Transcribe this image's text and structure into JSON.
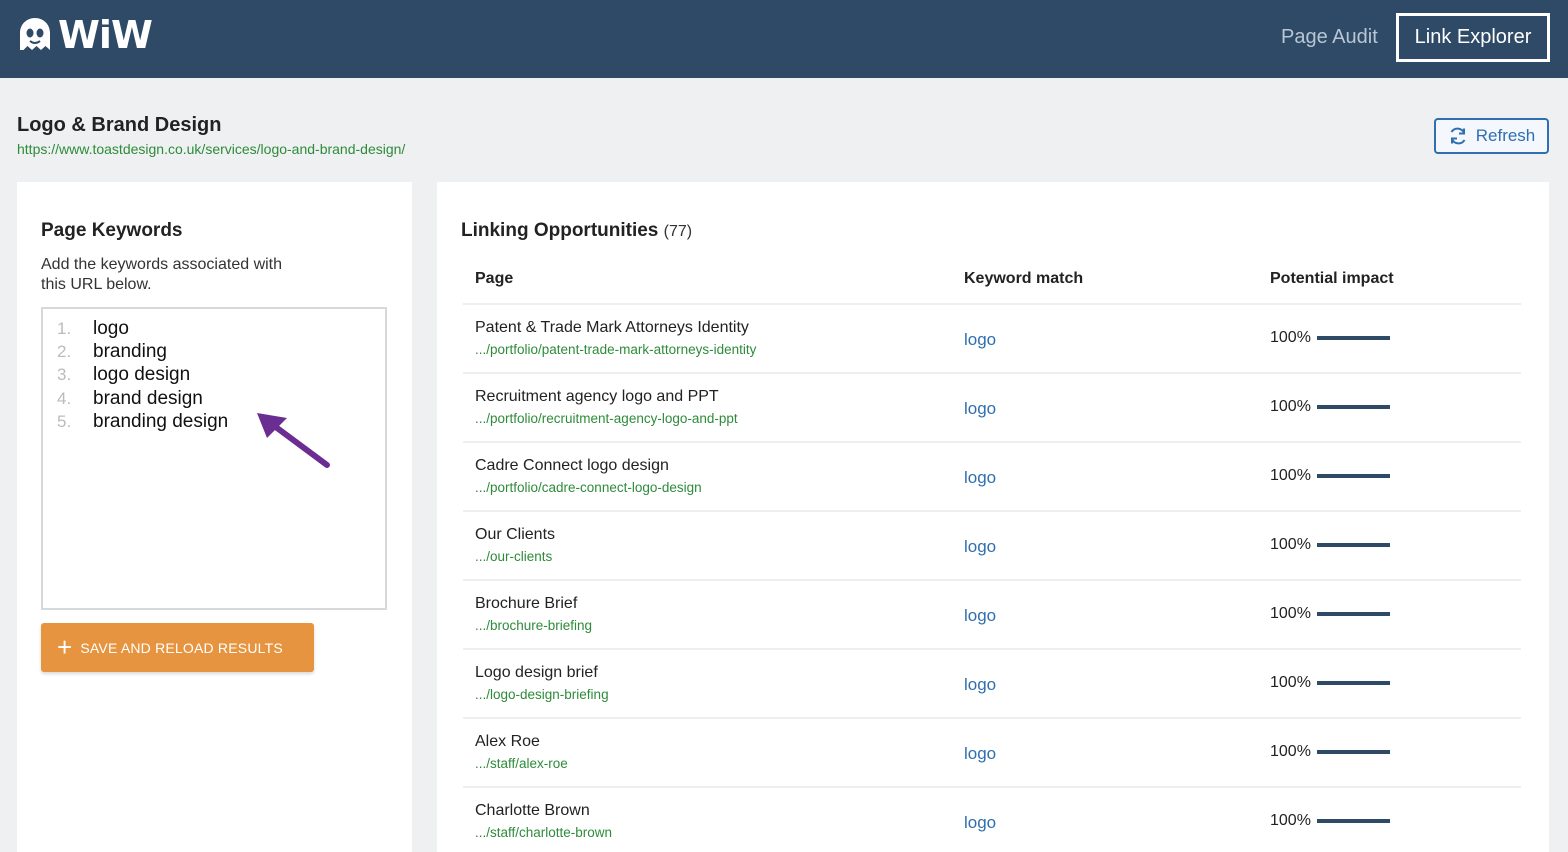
{
  "brand": {
    "name": "WiW",
    "accent": "#2e4a67"
  },
  "nav": {
    "page_audit": "Page Audit",
    "link_explorer": "Link Explorer"
  },
  "page": {
    "title": "Logo & Brand Design",
    "url": "https://www.toastdesign.co.uk/services/logo-and-brand-design/"
  },
  "refresh": {
    "label": "Refresh",
    "icon": "refresh-icon"
  },
  "keywords": {
    "title": "Page Keywords",
    "description": "Add the keywords associated with this URL below.",
    "items": [
      {
        "num": "1.",
        "word": "logo"
      },
      {
        "num": "2.",
        "word": "branding"
      },
      {
        "num": "3.",
        "word": "logo design"
      },
      {
        "num": "4.",
        "word": "brand design"
      },
      {
        "num": "5.",
        "word": "branding design"
      }
    ],
    "save_label": "SAVE AND RELOAD RESULTS"
  },
  "opportunities": {
    "title": "Linking Opportunities",
    "count": "(77)",
    "columns": {
      "page": "Page",
      "keyword": "Keyword match",
      "impact": "Potential impact"
    },
    "rows": [
      {
        "title": "Patent & Trade Mark Attorneys Identity",
        "url": ".../portfolio/patent-trade-mark-attorneys-identity",
        "keyword": "logo",
        "impact": "100%",
        "impact_value": 1.0
      },
      {
        "title": "Recruitment agency logo and PPT",
        "url": ".../portfolio/recruitment-agency-logo-and-ppt",
        "keyword": "logo",
        "impact": "100%",
        "impact_value": 1.0
      },
      {
        "title": "Cadre Connect logo design",
        "url": ".../portfolio/cadre-connect-logo-design",
        "keyword": "logo",
        "impact": "100%",
        "impact_value": 1.0
      },
      {
        "title": "Our Clients",
        "url": ".../our-clients",
        "keyword": "logo",
        "impact": "100%",
        "impact_value": 1.0
      },
      {
        "title": "Brochure Brief",
        "url": ".../brochure-briefing",
        "keyword": "logo",
        "impact": "100%",
        "impact_value": 1.0
      },
      {
        "title": "Logo design brief",
        "url": ".../logo-design-briefing",
        "keyword": "logo",
        "impact": "100%",
        "impact_value": 1.0
      },
      {
        "title": "Alex Roe",
        "url": ".../staff/alex-roe",
        "keyword": "logo",
        "impact": "100%",
        "impact_value": 1.0
      },
      {
        "title": "Charlotte Brown",
        "url": ".../staff/charlotte-brown",
        "keyword": "logo",
        "impact": "100%",
        "impact_value": 1.0
      }
    ]
  }
}
